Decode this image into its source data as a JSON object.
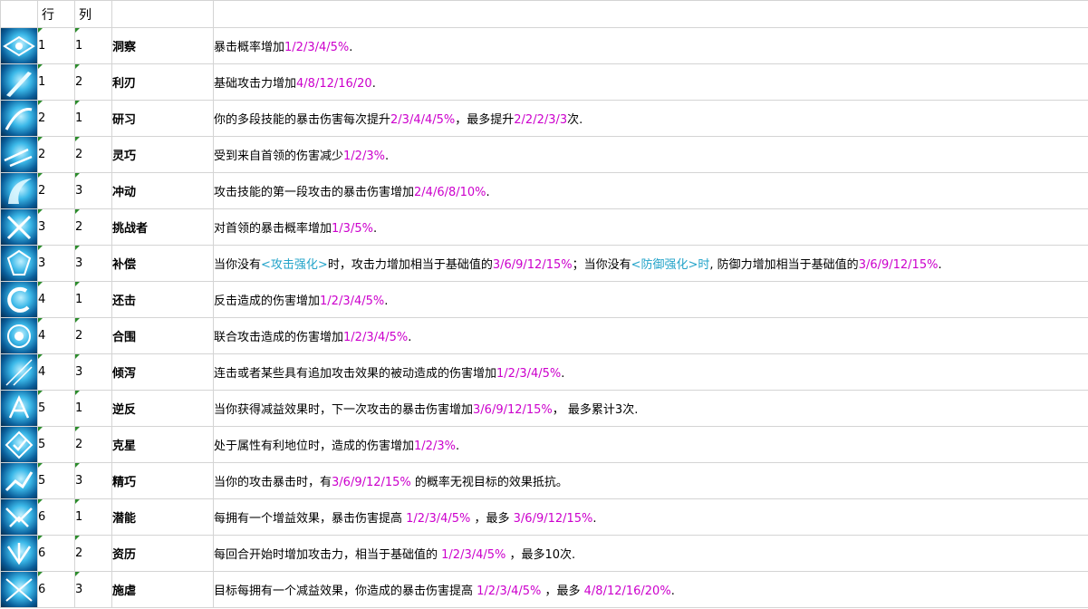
{
  "headers": {
    "icon": "",
    "row": "行",
    "col": "列",
    "name": "",
    "desc": ""
  },
  "colors": {
    "highlight": "#cc00cc",
    "keyword": "#22a3c9"
  },
  "rows": [
    {
      "icon": "eye-icon",
      "row": "1",
      "col": "1",
      "name": "洞察",
      "desc": [
        {
          "t": "暴击概率增加"
        },
        {
          "t": "1/2/3/4/5%",
          "c": "hl"
        },
        {
          "t": "."
        }
      ]
    },
    {
      "icon": "blade-icon",
      "row": "1",
      "col": "2",
      "name": "利刃",
      "desc": [
        {
          "t": "基础攻击力增加"
        },
        {
          "t": "4/8/12/16/20",
          "c": "hl"
        },
        {
          "t": "."
        }
      ]
    },
    {
      "icon": "slash-icon",
      "row": "2",
      "col": "1",
      "name": "研习",
      "desc": [
        {
          "t": "你的多段技能的暴击伤害每次提升"
        },
        {
          "t": "2/3/4/4/5%",
          "c": "hl"
        },
        {
          "t": "，最多提升"
        },
        {
          "t": "2/2/2/3/3",
          "c": "hl"
        },
        {
          "t": "次."
        }
      ]
    },
    {
      "icon": "dash-icon",
      "row": "2",
      "col": "2",
      "name": "灵巧",
      "desc": [
        {
          "t": "受到来自首领的伤害减少"
        },
        {
          "t": "1/2/3%",
          "c": "hl"
        },
        {
          "t": "."
        }
      ]
    },
    {
      "icon": "claw-icon",
      "row": "2",
      "col": "3",
      "name": "冲动",
      "desc": [
        {
          "t": "攻击技能的第一段攻击的暴击伤害增加"
        },
        {
          "t": "2/4/6/8/10%",
          "c": "hl"
        },
        {
          "t": "."
        }
      ]
    },
    {
      "icon": "challenger-icon",
      "row": "3",
      "col": "2",
      "name": "挑战者",
      "desc": [
        {
          "t": "对首领的暴击概率增加"
        },
        {
          "t": "1/3/5%",
          "c": "hl"
        },
        {
          "t": "."
        }
      ]
    },
    {
      "icon": "compensation-icon",
      "row": "3",
      "col": "3",
      "name": "补偿",
      "desc": [
        {
          "t": "当你没有"
        },
        {
          "t": "<攻击强化>",
          "c": "kw"
        },
        {
          "t": "时，攻击力增加相当于基础值的"
        },
        {
          "t": "3/6/9/12/15%",
          "c": "hl"
        },
        {
          "t": "；当你没有"
        },
        {
          "t": "<防御强化>时",
          "c": "kw"
        },
        {
          "t": ", 防御力增加相当于基础值的"
        },
        {
          "t": "3/6/9/12/15%",
          "c": "hl"
        },
        {
          "t": "."
        }
      ]
    },
    {
      "icon": "counter-icon",
      "row": "4",
      "col": "1",
      "name": "还击",
      "desc": [
        {
          "t": "反击造成的伤害增加"
        },
        {
          "t": "1/2/3/4/5%",
          "c": "hl"
        },
        {
          "t": "."
        }
      ]
    },
    {
      "icon": "target-icon",
      "row": "4",
      "col": "2",
      "name": "合围",
      "desc": [
        {
          "t": "联合攻击造成的伤害增加"
        },
        {
          "t": "1/2/3/4/5%",
          "c": "hl"
        },
        {
          "t": "."
        }
      ]
    },
    {
      "icon": "feather-icon",
      "row": "4",
      "col": "3",
      "name": "倾泻",
      "desc": [
        {
          "t": "连击或者某些具有追加攻击效果的被动造成的伤害增加"
        },
        {
          "t": "1/2/3/4/5%",
          "c": "hl"
        },
        {
          "t": "."
        }
      ]
    },
    {
      "icon": "reverse-icon",
      "row": "5",
      "col": "1",
      "name": "逆反",
      "desc": [
        {
          "t": "当你获得减益效果时，下一次攻击的暴击伤害增加"
        },
        {
          "t": "3/6/9/12/15%",
          "c": "hl"
        },
        {
          "t": "， 最多累计3次."
        }
      ]
    },
    {
      "icon": "nemesis-icon",
      "row": "5",
      "col": "2",
      "name": "克星",
      "desc": [
        {
          "t": "处于属性有利地位时，造成的伤害增加"
        },
        {
          "t": "1/2/3%",
          "c": "hl"
        },
        {
          "t": "."
        }
      ]
    },
    {
      "icon": "precision-icon",
      "row": "5",
      "col": "3",
      "name": "精巧",
      "desc": [
        {
          "t": "当你的攻击暴击时，有"
        },
        {
          "t": "3/6/9/12/15%",
          "c": "hl"
        },
        {
          "t": " 的概率无视目标的效果抵抗。"
        }
      ]
    },
    {
      "icon": "potential-icon",
      "row": "6",
      "col": "1",
      "name": "潜能",
      "desc": [
        {
          "t": "每拥有一个增益效果，暴击伤害提高 "
        },
        {
          "t": "1/2/3/4/5%",
          "c": "hl"
        },
        {
          "t": " ，最多 "
        },
        {
          "t": "3/6/9/12/15%",
          "c": "hl"
        },
        {
          "t": "."
        }
      ]
    },
    {
      "icon": "experience-icon",
      "row": "6",
      "col": "2",
      "name": "资历",
      "desc": [
        {
          "t": "每回合开始时增加攻击力，相当于基础值的 "
        },
        {
          "t": "1/2/3/4/5%",
          "c": "hl"
        },
        {
          "t": " ，最多10次."
        }
      ]
    },
    {
      "icon": "cruelty-icon",
      "row": "6",
      "col": "3",
      "name": "施虐",
      "desc": [
        {
          "t": "目标每拥有一个减益效果，你造成的暴击伤害提高 "
        },
        {
          "t": "1/2/3/4/5%",
          "c": "hl"
        },
        {
          "t": " ，最多 "
        },
        {
          "t": "4/8/12/16/20%",
          "c": "hl"
        },
        {
          "t": "."
        }
      ]
    }
  ]
}
